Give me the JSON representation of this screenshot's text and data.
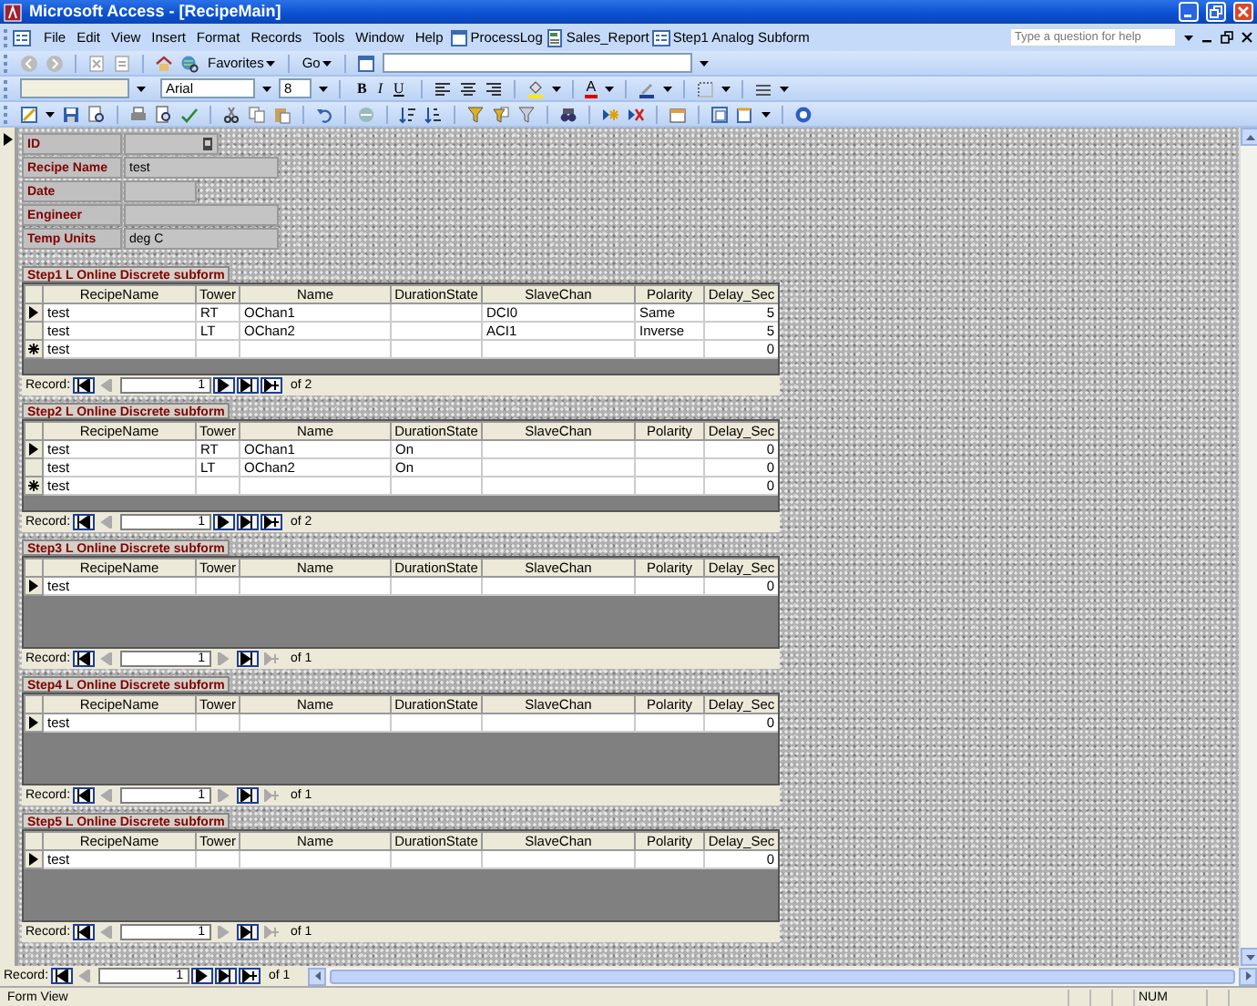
{
  "window": {
    "title": "Microsoft Access - [RecipeMain]"
  },
  "menu": [
    {
      "label": "File"
    },
    {
      "label": "Edit"
    },
    {
      "label": "View"
    },
    {
      "label": "Insert"
    },
    {
      "label": "Format"
    },
    {
      "label": "Records"
    },
    {
      "label": "Tools"
    },
    {
      "label": "Window"
    },
    {
      "label": "Help"
    }
  ],
  "shortcuts": [
    {
      "label": "ProcessLog"
    },
    {
      "label": "Sales_Report"
    },
    {
      "label": "Step1 Analog Subform"
    }
  ],
  "help_box": {
    "placeholder": "Type a question for help"
  },
  "web_toolbar": {
    "favorites": "Favorites",
    "go": "Go"
  },
  "format_toolbar": {
    "font": "Arial",
    "size": "8",
    "style_buttons": [
      "B",
      "I",
      "U"
    ],
    "font_color": "A"
  },
  "fields": [
    {
      "kind": "autonumber",
      "label": "ID"
    },
    {
      "kind": "text",
      "label": "Recipe Name",
      "value": "test"
    },
    {
      "kind": "date",
      "label": "Date"
    },
    {
      "kind": "text",
      "label": "Engineer"
    },
    {
      "kind": "text",
      "label": "Temp Units",
      "value": "deg C"
    }
  ],
  "subforms": [
    {
      "title": "Step1 L Online Discrete subform",
      "columns": [
        {
          "label": "RecipeName",
          "kind": "text"
        },
        {
          "label": "Tower",
          "kind": "text"
        },
        {
          "label": "Name",
          "kind": "text"
        },
        {
          "label": "DurationState",
          "kind": "text"
        },
        {
          "label": "SlaveChan",
          "kind": "text"
        },
        {
          "label": "Polarity",
          "kind": "text"
        },
        {
          "label": "Delay_Sec",
          "kind": "number"
        }
      ],
      "rows": [
        {
          "current": true,
          "new": false,
          "cells": [
            "test",
            "RT",
            "OChan1",
            null,
            "DCI0",
            "Same",
            "5"
          ]
        },
        {
          "current": false,
          "new": false,
          "cells": [
            "test",
            "LT",
            "OChan2",
            null,
            "ACI1",
            "Inverse",
            "5"
          ]
        },
        {
          "current": false,
          "new": true,
          "cells": [
            "test",
            null,
            null,
            null,
            null,
            null,
            "0"
          ]
        }
      ],
      "nav": {
        "label": "Record:",
        "current": "1",
        "total": "of 2",
        "first_enabled": true,
        "prev_enabled": false,
        "next_enabled": true,
        "last_enabled": true,
        "new_enabled": true
      }
    },
    {
      "title": "Step2 L Online Discrete subform",
      "columns": [
        {
          "label": "RecipeName",
          "kind": "text"
        },
        {
          "label": "Tower",
          "kind": "text"
        },
        {
          "label": "Name",
          "kind": "text"
        },
        {
          "label": "DurationState",
          "kind": "text"
        },
        {
          "label": "SlaveChan",
          "kind": "text"
        },
        {
          "label": "Polarity",
          "kind": "text"
        },
        {
          "label": "Delay_Sec",
          "kind": "number"
        }
      ],
      "rows": [
        {
          "current": true,
          "new": false,
          "cells": [
            "test",
            "RT",
            "OChan1",
            "On",
            null,
            null,
            "0"
          ]
        },
        {
          "current": false,
          "new": false,
          "cells": [
            "test",
            "LT",
            "OChan2",
            "On",
            null,
            null,
            "0"
          ]
        },
        {
          "current": false,
          "new": true,
          "cells": [
            "test",
            null,
            null,
            null,
            null,
            null,
            "0"
          ]
        }
      ],
      "nav": {
        "label": "Record:",
        "current": "1",
        "total": "of 2",
        "first_enabled": true,
        "prev_enabled": false,
        "next_enabled": true,
        "last_enabled": true,
        "new_enabled": true
      }
    },
    {
      "title": "Step3 L Online Discrete subform",
      "columns": [
        {
          "label": "RecipeName",
          "kind": "text"
        },
        {
          "label": "Tower",
          "kind": "text"
        },
        {
          "label": "Name",
          "kind": "text"
        },
        {
          "label": "DurationState",
          "kind": "text"
        },
        {
          "label": "SlaveChan",
          "kind": "text"
        },
        {
          "label": "Polarity",
          "kind": "text"
        },
        {
          "label": "Delay_Sec",
          "kind": "number"
        }
      ],
      "rows": [
        {
          "current": true,
          "new": false,
          "cells": [
            "test",
            null,
            null,
            null,
            null,
            null,
            "0"
          ]
        }
      ],
      "nav": {
        "label": "Record:",
        "current": "1",
        "total": "of 1",
        "first_enabled": true,
        "prev_enabled": false,
        "next_enabled": false,
        "last_enabled": true,
        "new_enabled": false
      }
    },
    {
      "title": "Step4 L Online Discrete subform",
      "columns": [
        {
          "label": "RecipeName",
          "kind": "text"
        },
        {
          "label": "Tower",
          "kind": "text"
        },
        {
          "label": "Name",
          "kind": "text"
        },
        {
          "label": "DurationState",
          "kind": "text"
        },
        {
          "label": "SlaveChan",
          "kind": "text"
        },
        {
          "label": "Polarity",
          "kind": "text"
        },
        {
          "label": "Delay_Sec",
          "kind": "number"
        }
      ],
      "rows": [
        {
          "current": true,
          "new": false,
          "cells": [
            "test",
            null,
            null,
            null,
            null,
            null,
            "0"
          ]
        }
      ],
      "nav": {
        "label": "Record:",
        "current": "1",
        "total": "of 1",
        "first_enabled": true,
        "prev_enabled": false,
        "next_enabled": false,
        "last_enabled": true,
        "new_enabled": false
      }
    },
    {
      "title": "Step5 L Online Discrete subform",
      "columns": [
        {
          "label": "RecipeName",
          "kind": "text"
        },
        {
          "label": "Tower",
          "kind": "text"
        },
        {
          "label": "Name",
          "kind": "text"
        },
        {
          "label": "DurationState",
          "kind": "text"
        },
        {
          "label": "SlaveChan",
          "kind": "text"
        },
        {
          "label": "Polarity",
          "kind": "text"
        },
        {
          "label": "Delay_Sec",
          "kind": "number"
        }
      ],
      "rows": [
        {
          "current": true,
          "new": false,
          "cells": [
            "test",
            null,
            null,
            null,
            null,
            null,
            "0"
          ]
        }
      ],
      "nav": {
        "label": "Record:",
        "current": "1",
        "total": "of 1",
        "first_enabled": true,
        "prev_enabled": false,
        "next_enabled": false,
        "last_enabled": true,
        "new_enabled": false
      }
    }
  ],
  "main_nav": {
    "label": "Record:",
    "current": "1",
    "total": "of 1",
    "first_enabled": true,
    "prev_enabled": false,
    "next_enabled": true,
    "last_enabled": true,
    "new_enabled": true
  },
  "status_bar": {
    "text": "Form View",
    "indicators": [
      "NUM"
    ]
  }
}
